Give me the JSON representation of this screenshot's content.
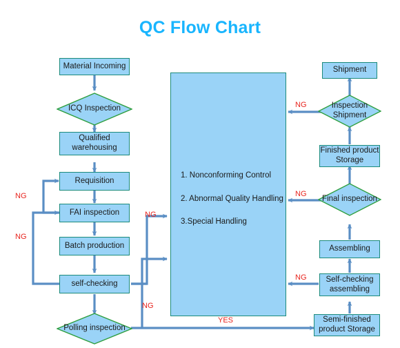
{
  "page": {
    "title": "QC Flow Chart",
    "background_color": "#ffffff",
    "title_color": "#19b5fe",
    "node_fill": "#9ad3f7",
    "node_border": "#1a8a7a",
    "connector_color": "#5a8ec4",
    "label_color": "#e8241e"
  },
  "nodes": {
    "material_incoming": "Material Incoming",
    "icq_inspection": "ICQ Inspection",
    "qualified_warehousing": "Qualified warehousing",
    "requisition": "Requisition",
    "fai_inspection": "FAI inspection",
    "batch_production": "Batch production",
    "self_checking": "self-checking",
    "polling_inspection": "Polling inspection",
    "shipment": "Shipment",
    "inspection_shipment": "Inspection Shipment",
    "finished_product_storage": "Finished product Storage",
    "final_inspection": "Final inspection",
    "assembling": "Assembling",
    "self_checking_assembling": "Self-checking assembling",
    "semi_finished_product_storage": "Semi-finished product Storage"
  },
  "center_box": {
    "items": [
      "1. Nonconforming Control",
      "2. Abnormal Quality Handling",
      "3.Special Handling"
    ]
  },
  "edge_labels": {
    "ng_requisition_loop": "NG",
    "ng_fai_loop": "NG",
    "ng_fai_to_center": "NG",
    "ng_polling_to_center": "NG",
    "ng_inspection_shipment": "NG",
    "ng_final_inspection": "NG",
    "ng_self_checking_assembling": "NG",
    "yes_polling": "YES"
  }
}
